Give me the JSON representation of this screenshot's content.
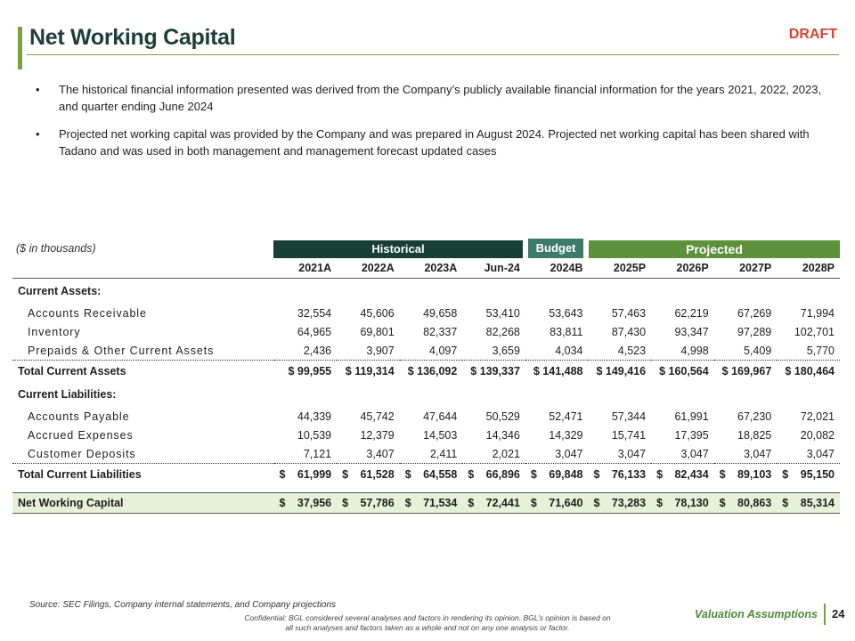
{
  "header": {
    "title": "Net Working Capital",
    "draft": "DRAFT"
  },
  "bullets": [
    "The historical financial information presented was derived from the Company’s publicly available financial information for the years 2021, 2022, 2023, and quarter ending June 2024",
    "Projected net working capital was provided by the Company and was prepared in August 2024. Projected net working capital has been shared with Tadano and was used in both management and management forecast updated cases"
  ],
  "bullet_symbol": "•",
  "table": {
    "units_label": "($ in thousands)",
    "groups": {
      "historical": "Historical",
      "budget": "Budget",
      "projected": "Projected"
    },
    "columns": [
      "2021A",
      "2022A",
      "2023A",
      "Jun-24",
      "2024B",
      "2025P",
      "2026P",
      "2027P",
      "2028P"
    ],
    "current_assets_label": "Current Assets:",
    "current_assets": [
      {
        "label": "Accounts Receivable",
        "values": [
          "32,554",
          "45,606",
          "49,658",
          "53,410",
          "53,643",
          "57,463",
          "62,219",
          "67,269",
          "71,994"
        ]
      },
      {
        "label": "Inventory",
        "values": [
          "64,965",
          "69,801",
          "82,337",
          "82,268",
          "83,811",
          "87,430",
          "93,347",
          "97,289",
          "102,701"
        ]
      },
      {
        "label": "Prepaids & Other Current Assets",
        "values": [
          "2,436",
          "3,907",
          "4,097",
          "3,659",
          "4,034",
          "4,523",
          "4,998",
          "5,409",
          "5,770"
        ]
      }
    ],
    "total_current_assets": {
      "label": "Total Current Assets",
      "values": [
        "$ 99,955",
        "$ 119,314",
        "$ 136,092",
        "$ 139,337",
        "$ 141,488",
        "$ 149,416",
        "$ 160,564",
        "$ 169,967",
        "$ 180,464"
      ]
    },
    "current_liabilities_label": "Current Liabilities:",
    "current_liabilities": [
      {
        "label": "Accounts Payable",
        "values": [
          "44,339",
          "45,742",
          "47,644",
          "50,529",
          "52,471",
          "57,344",
          "61,991",
          "67,230",
          "72,021"
        ]
      },
      {
        "label": "Accrued Expenses",
        "values": [
          "10,539",
          "12,379",
          "14,503",
          "14,346",
          "14,329",
          "15,741",
          "17,395",
          "18,825",
          "20,082"
        ]
      },
      {
        "label": "Customer Deposits",
        "values": [
          "7,121",
          "3,407",
          "2,411",
          "2,021",
          "3,047",
          "3,047",
          "3,047",
          "3,047",
          "3,047"
        ]
      }
    ],
    "total_current_liabilities": {
      "label": "Total Current Liabilities",
      "values": [
        "61,999",
        "61,528",
        "64,558",
        "66,896",
        "69,848",
        "76,133",
        "82,434",
        "89,103",
        "95,150"
      ]
    },
    "net_working_capital": {
      "label": "Net Working Capital",
      "values": [
        "37,956",
        "57,786",
        "71,534",
        "72,441",
        "71,640",
        "73,283",
        "78,130",
        "80,863",
        "85,314"
      ]
    },
    "dollar_sign": "$"
  },
  "footer": {
    "source": "Source: SEC Filings, Company internal statements, and Company projections",
    "section": "Valuation Assumptions",
    "page": "24",
    "confidential": "Confidential: BGL considered several analyses and factors in rendering its opinion. BGL’s opinion is based on all such analyses and factors taken as a whole and not on any one analysis or factor."
  }
}
